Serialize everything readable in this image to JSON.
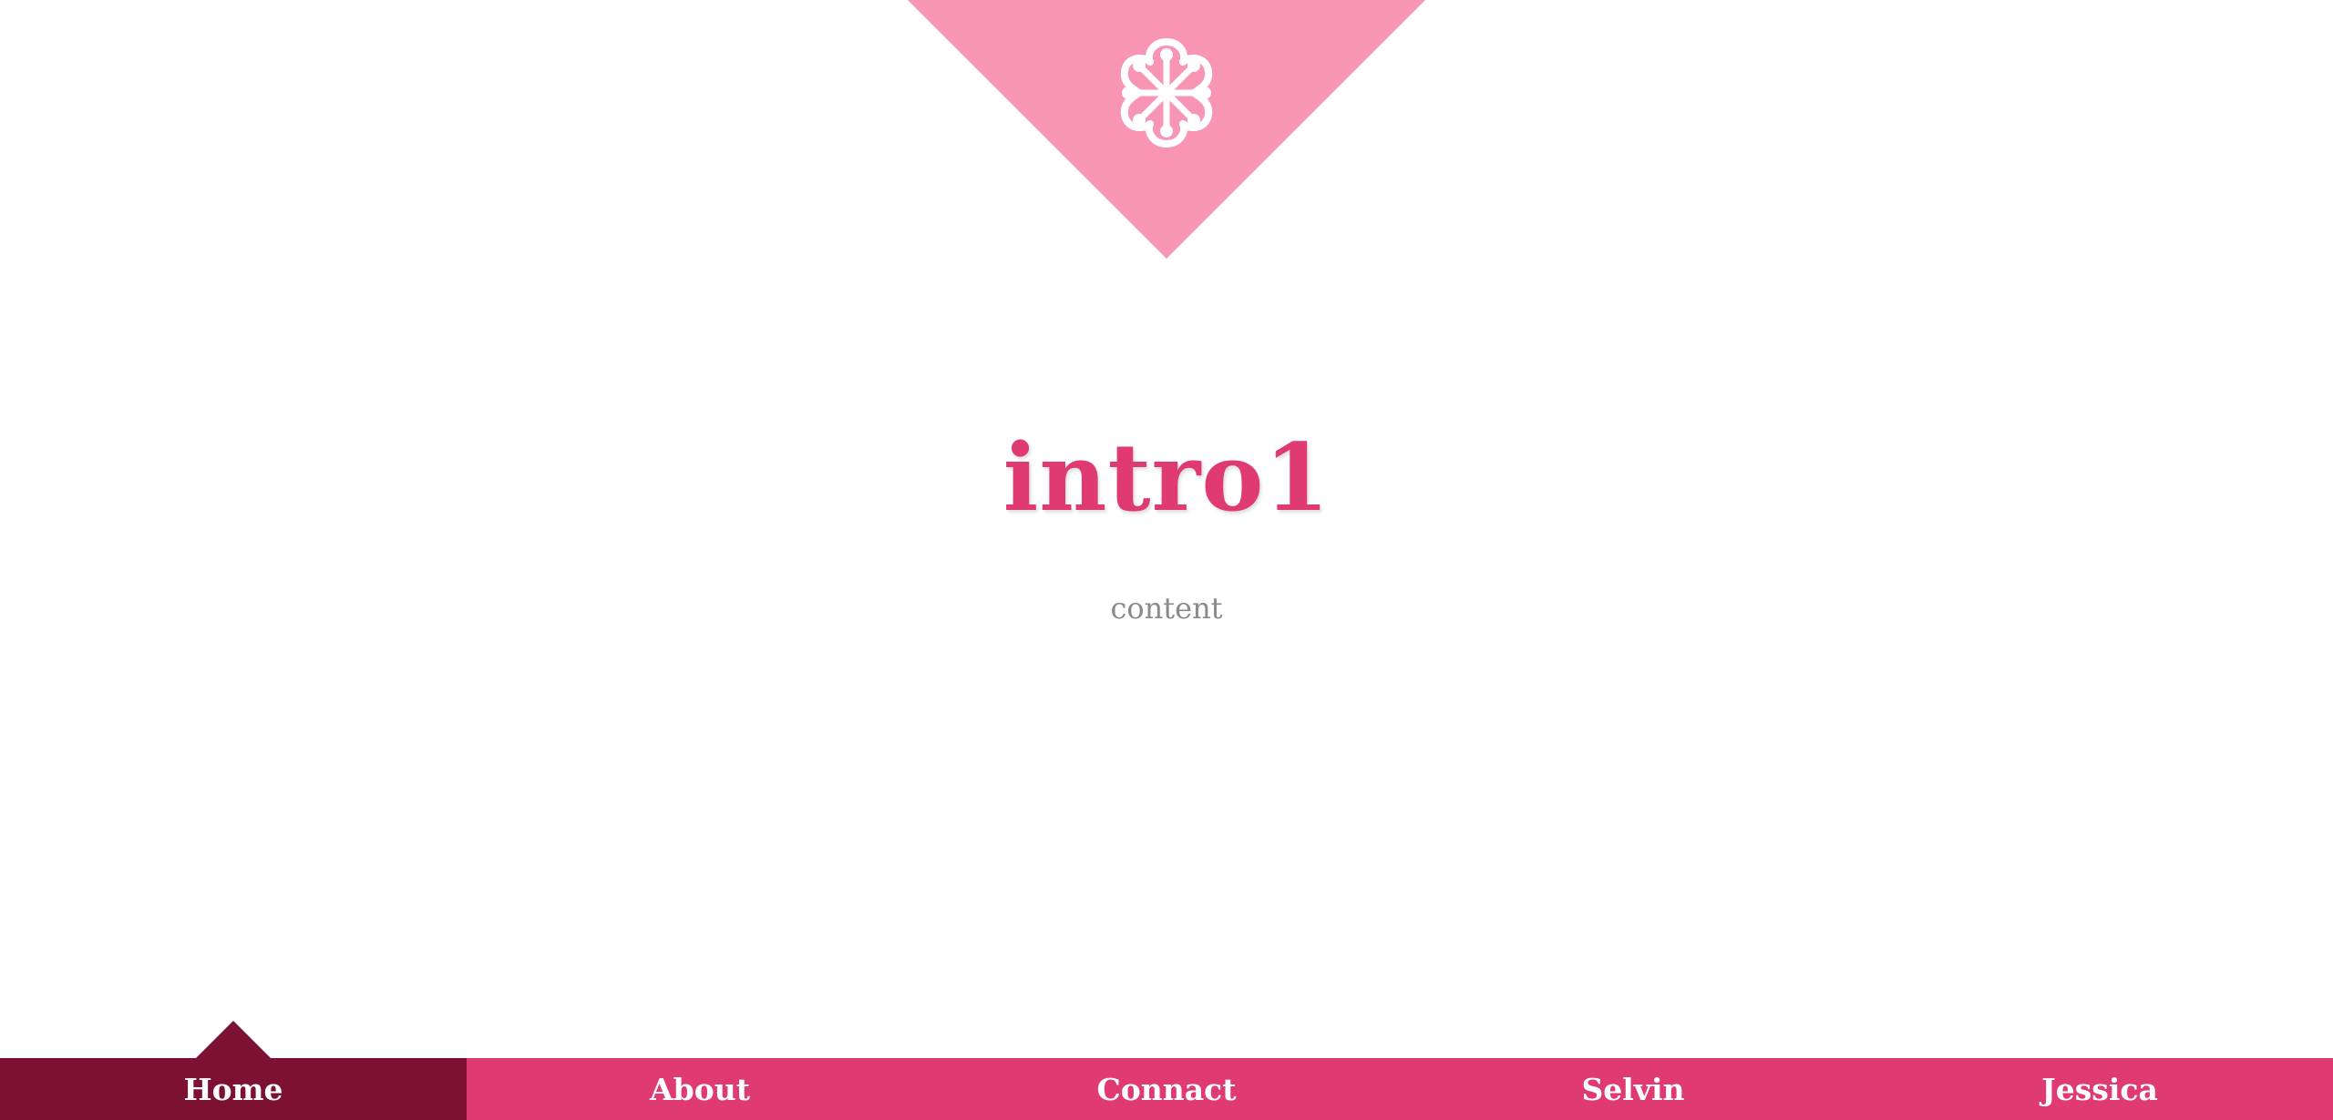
{
  "hero": {
    "logo_icon": "flower-logo-icon",
    "triangle_color": "#f895b4"
  },
  "intro": {
    "title": "intro1",
    "content": "content"
  },
  "nav": {
    "active_index": 0,
    "items": [
      {
        "label": "Home"
      },
      {
        "label": "About"
      },
      {
        "label": "Connact"
      },
      {
        "label": "Selvin"
      },
      {
        "label": "Jessica"
      }
    ]
  },
  "colors": {
    "accent": "#e03a72",
    "nav_active": "#7c1133",
    "text_muted": "#8a8a8a",
    "triangle": "#f895b4"
  }
}
